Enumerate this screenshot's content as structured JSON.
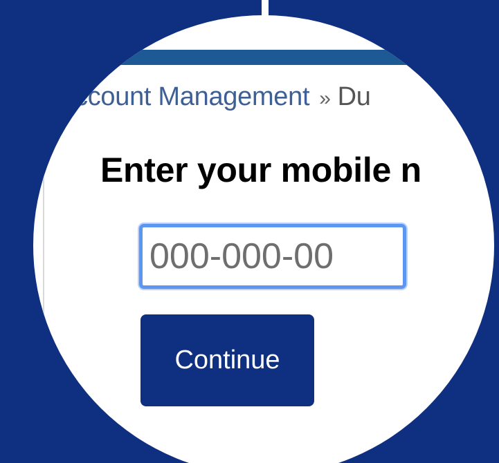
{
  "breadcrumb": {
    "link_label": "ccount Management",
    "separator": "»",
    "current_label": "Du"
  },
  "page": {
    "title": "Enter your mobile n"
  },
  "phone_input": {
    "value": "",
    "placeholder": "000-000-00"
  },
  "continue_button": {
    "label": "Continue"
  },
  "colors": {
    "background": "#0f3080",
    "header_bar": "#1d5a95",
    "link": "#3d5f96",
    "button": "#0f3080",
    "focus_ring": "#5d96f0"
  }
}
